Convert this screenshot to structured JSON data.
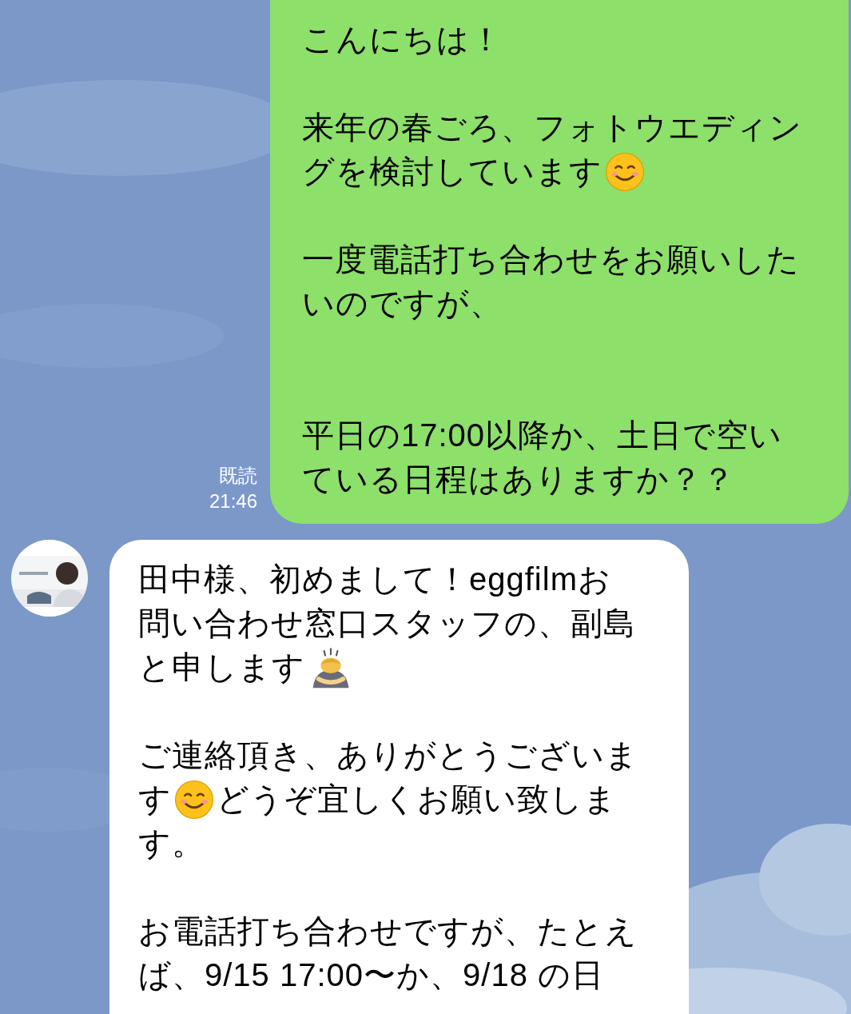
{
  "messages": [
    {
      "kind": "sent",
      "read_label": "既読",
      "time": "21:46",
      "lines": [
        [
          {
            "kind": "text",
            "text": "こんにちは！"
          }
        ],
        [
          {
            "kind": "blank"
          }
        ],
        [
          {
            "kind": "text",
            "text": "来年の春ごろ、フォトウエディン"
          }
        ],
        [
          {
            "kind": "text",
            "text": "グを検討しています"
          },
          {
            "kind": "smile"
          }
        ],
        [
          {
            "kind": "blank"
          }
        ],
        [
          {
            "kind": "text",
            "text": "一度電話打ち合わせをお願いした"
          }
        ],
        [
          {
            "kind": "text",
            "text": "いのですが、"
          }
        ],
        [
          {
            "kind": "blank"
          }
        ],
        [
          {
            "kind": "blank"
          }
        ],
        [
          {
            "kind": "text",
            "text": "平日の17:00以降か、土日で空い"
          }
        ],
        [
          {
            "kind": "text",
            "text": "ている日程はありますか？？"
          }
        ]
      ]
    },
    {
      "kind": "received",
      "avatar": {
        "kind": "picture"
      },
      "lines": [
        [
          {
            "kind": "text",
            "text": "田中様、初めまして！eggfilmお"
          }
        ],
        [
          {
            "kind": "text",
            "text": "問い合わせ窓口スタッフの、副島"
          }
        ],
        [
          {
            "kind": "text",
            "text": "と申します"
          },
          {
            "kind": "bow"
          }
        ],
        [
          {
            "kind": "blank"
          }
        ],
        [
          {
            "kind": "text",
            "text": "ご連絡頂き、ありがとうございま"
          }
        ],
        [
          {
            "kind": "text",
            "text": "す"
          },
          {
            "kind": "smile"
          },
          {
            "kind": "text",
            "text": "どうぞ宜しくお願い致しま"
          }
        ],
        [
          {
            "kind": "text",
            "text": "す。"
          }
        ],
        [
          {
            "kind": "blank"
          }
        ],
        [
          {
            "kind": "text",
            "text": "お電話打ち合わせですが、たとえ"
          }
        ],
        [
          {
            "kind": "text",
            "text": "ば、9/15 17:00〜か、9/18 の日"
          }
        ]
      ]
    }
  ]
}
